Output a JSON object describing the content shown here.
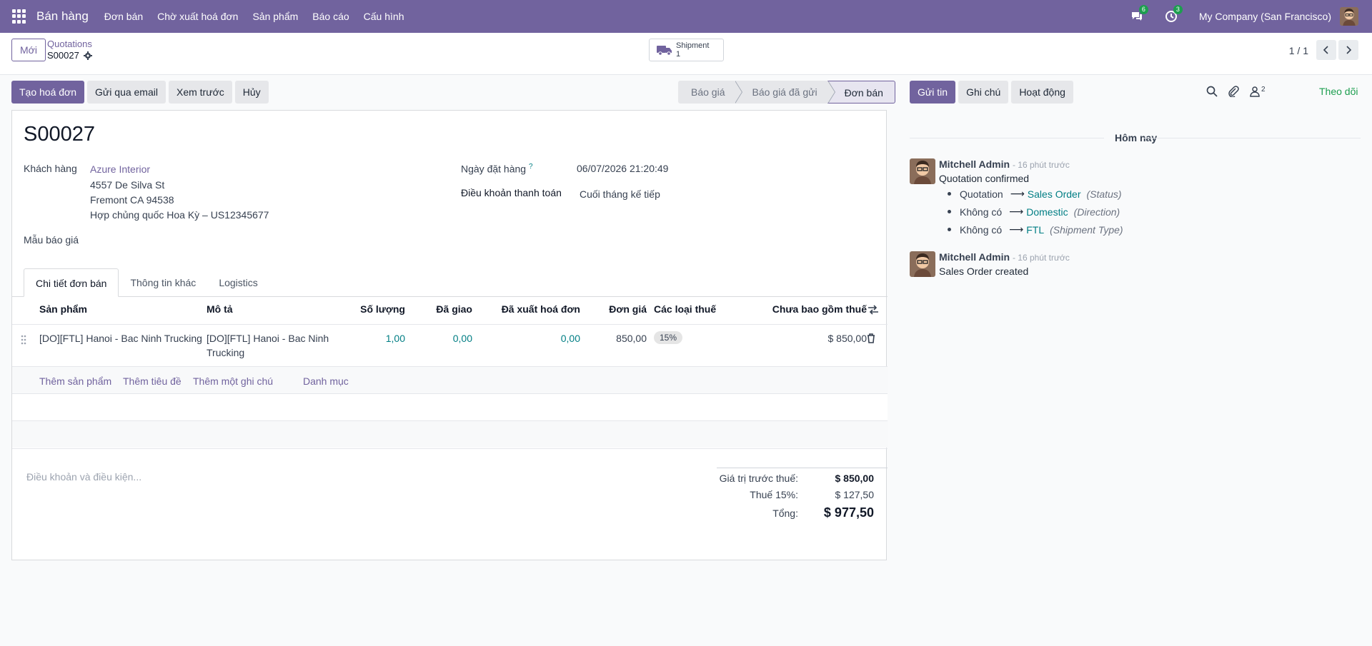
{
  "navbar": {
    "brand": "Bán hàng",
    "menu": [
      "Đơn bán",
      "Chờ xuất hoá đơn",
      "Sản phẩm",
      "Báo cáo",
      "Cấu hình"
    ],
    "messages_count": "6",
    "activities_count": "3",
    "company": "My Company (San Francisco)"
  },
  "control": {
    "new_label": "Mới",
    "breadcrumb_parent": "Quotations",
    "breadcrumb_current": "S00027",
    "shipment_label": "Shipment",
    "shipment_count": "1",
    "pager": "1 / 1"
  },
  "actions": {
    "create_invoice": "Tạo hoá đơn",
    "send_email": "Gửi qua email",
    "preview": "Xem trước",
    "cancel": "Hủy"
  },
  "status": {
    "stages": [
      "Báo giá",
      "Báo giá đã gửi",
      "Đơn bán"
    ],
    "active": "Đơn bán"
  },
  "form": {
    "name": "S00027",
    "customer_label": "Khách hàng",
    "customer_name": "Azure Interior",
    "address_line1": "4557 De Silva St",
    "address_line2": "Fremont CA 94538",
    "address_line3": "Hợp chủng quốc Hoa Kỳ – US12345677",
    "template_label": "Mẫu báo giá",
    "order_date_label": "Ngày đặt hàng",
    "order_date_help": "?",
    "order_date": "06/07/2026 21:20:49",
    "payment_terms_label": "Điều khoản thanh toán",
    "payment_terms": "Cuối tháng kế tiếp"
  },
  "tabs": [
    "Chi tiết đơn bán",
    "Thông tin khác",
    "Logistics"
  ],
  "table": {
    "headers": {
      "product": "Sản phẩm",
      "description": "Mô tả",
      "quantity": "Số lượng",
      "delivered": "Đã giao",
      "invoiced": "Đã xuất hoá đơn",
      "unit_price": "Đơn giá",
      "taxes": "Các loại thuế",
      "subtotal": "Chưa bao gồm thuế"
    },
    "rows": [
      {
        "product": "[DO][FTL] Hanoi - Bac Ninh Trucking",
        "description_line1": "[DO][FTL]  Hanoi - Bac Ninh",
        "description_line2": "Trucking",
        "quantity": "1,00",
        "delivered": "0,00",
        "invoiced": "0,00",
        "unit_price": "850,00",
        "tax": "15%",
        "subtotal": "$ 850,00"
      }
    ],
    "add_product": "Thêm sản phẩm",
    "add_section": "Thêm tiêu đề",
    "add_note": "Thêm một ghi chú",
    "catalog": "Danh mục"
  },
  "totals": {
    "terms_placeholder": "Điều khoản và điều kiện...",
    "untaxed_label": "Giá trị trước thuế:",
    "untaxed": "$ 850,00",
    "tax_label": "Thuế 15%:",
    "tax": "$ 127,50",
    "total_label": "Tổng:",
    "total": "$ 977,50"
  },
  "chatter": {
    "send_message": "Gửi tin",
    "log_note": "Ghi chú",
    "activities": "Hoạt động",
    "followers_count": "2",
    "follow": "Theo dõi",
    "date_separator": "Hôm nay",
    "messages": [
      {
        "author": "Mitchell Admin",
        "ago": "- 16 phút trước",
        "body": "Quotation confirmed",
        "tracking": [
          {
            "old": "Quotation",
            "new": "Sales Order",
            "field": "(Status)"
          },
          {
            "old": "Không có",
            "new": "Domestic",
            "field": "(Direction)"
          },
          {
            "old": "Không có",
            "new": "FTL",
            "field": "(Shipment Type)"
          }
        ]
      },
      {
        "author": "Mitchell Admin",
        "ago": "- 16 phút trước",
        "body": "Sales Order created"
      }
    ]
  },
  "colors": {
    "brand": "#71639e",
    "link": "#017e84",
    "success": "#1d9e4f"
  }
}
